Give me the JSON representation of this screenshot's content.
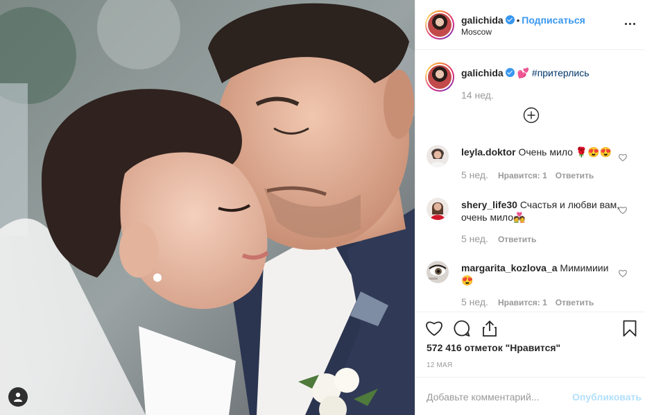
{
  "post": {
    "username": "galichida",
    "verified": true,
    "follow_label": "Подписаться",
    "location": "Moscow",
    "more_icon": "more-options-icon"
  },
  "caption": {
    "username": "galichida",
    "emoji": "💕",
    "hashtag": "#притерлись",
    "time": "14 нед.",
    "load_more_icon": "plus-circle-icon"
  },
  "comments": [
    {
      "username": "leyla.doktor",
      "text": "Очень мило",
      "emoji": "🌹😍😍",
      "time": "5 нед.",
      "likes_label": "Нравится: 1",
      "reply_label": "Ответить"
    },
    {
      "username": "shery_life30",
      "text": "Счастья и любви вам, очень мило",
      "emoji": "💑",
      "time": "5 нед.",
      "likes_label": "",
      "reply_label": "Ответить"
    },
    {
      "username": "margarita_kozlova_a",
      "text": "Мимимиии",
      "emoji": "😍",
      "time": "5 нед.",
      "likes_label": "Нравится: 1",
      "reply_label": "Ответить"
    }
  ],
  "actions": {
    "like_icon": "heart-icon",
    "comment_icon": "comment-bubble-icon",
    "share_icon": "share-icon",
    "save_icon": "bookmark-icon",
    "likes_count": "572 416 отметок \"Нравится\"",
    "date": "12 МАЯ"
  },
  "add_comment": {
    "placeholder": "Добавьте комментарий...",
    "publish_label": "Опубликовать"
  },
  "photo": {
    "tag_icon": "user-tag-icon"
  },
  "colors": {
    "link_blue": "#3897f0",
    "hashtag": "#003569",
    "muted": "#999999",
    "publish_disabled": "#b2dffc"
  }
}
